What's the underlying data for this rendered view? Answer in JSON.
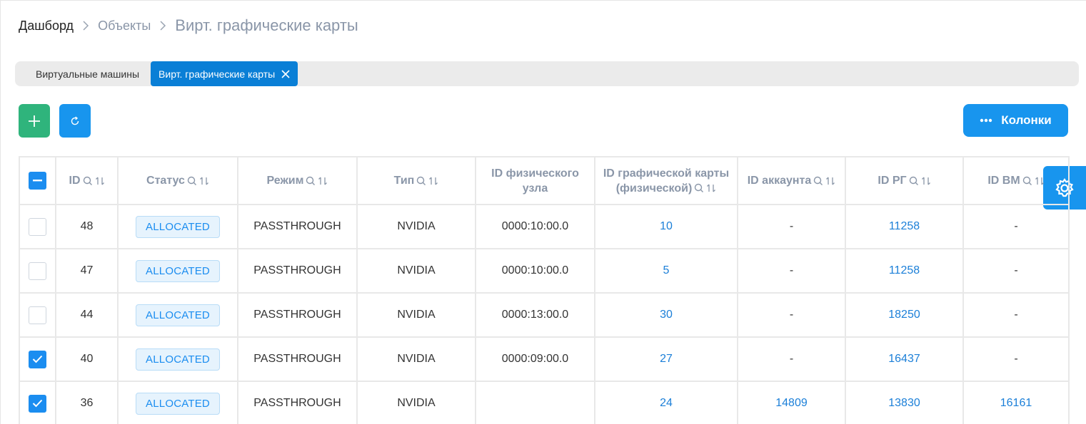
{
  "breadcrumb": {
    "items": [
      "Дашборд",
      "Объекты"
    ],
    "current": "Вирт. графические карты"
  },
  "tabs": {
    "inactive_label": "Виртуальные машины",
    "active_label": "Вирт. графические карты"
  },
  "toolbar": {
    "add_icon": "plus-icon",
    "refresh_icon": "refresh-icon",
    "columns_label": "Колонки",
    "settings_icon": "gear-icon"
  },
  "colors": {
    "add_button": "#2fb47c",
    "primary": "#1895ee",
    "active_tab": "#0a7fd6",
    "link": "#1b7fd8",
    "header_text": "#8a96a8"
  },
  "table": {
    "headers": {
      "id": "ID",
      "status": "Статус",
      "mode": "Режим",
      "type": "Тип",
      "phys_node": "ID физического узла",
      "gpu_phys": "ID графической карты (физической)",
      "account": "ID аккаунта",
      "rg": "ID РГ",
      "vm": "ID ВМ"
    },
    "rows": [
      {
        "checked": false,
        "id": "48",
        "status": "ALLOCATED",
        "mode": "PASSTHROUGH",
        "type": "NVIDIA",
        "phys_node": "0000:10:00.0",
        "gpu_phys": "10",
        "account": "-",
        "rg": "11258",
        "vm": "-"
      },
      {
        "checked": false,
        "id": "47",
        "status": "ALLOCATED",
        "mode": "PASSTHROUGH",
        "type": "NVIDIA",
        "phys_node": "0000:10:00.0",
        "gpu_phys": "5",
        "account": "-",
        "rg": "11258",
        "vm": "-"
      },
      {
        "checked": false,
        "id": "44",
        "status": "ALLOCATED",
        "mode": "PASSTHROUGH",
        "type": "NVIDIA",
        "phys_node": "0000:13:00.0",
        "gpu_phys": "30",
        "account": "-",
        "rg": "18250",
        "vm": "-"
      },
      {
        "checked": true,
        "id": "40",
        "status": "ALLOCATED",
        "mode": "PASSTHROUGH",
        "type": "NVIDIA",
        "phys_node": "0000:09:00.0",
        "gpu_phys": "27",
        "account": "-",
        "rg": "16437",
        "vm": "-"
      },
      {
        "checked": true,
        "id": "36",
        "status": "ALLOCATED",
        "mode": "PASSTHROUGH",
        "type": "NVIDIA",
        "phys_node": "",
        "gpu_phys": "24",
        "account": "14809",
        "rg": "13830",
        "vm": "16161"
      }
    ]
  }
}
